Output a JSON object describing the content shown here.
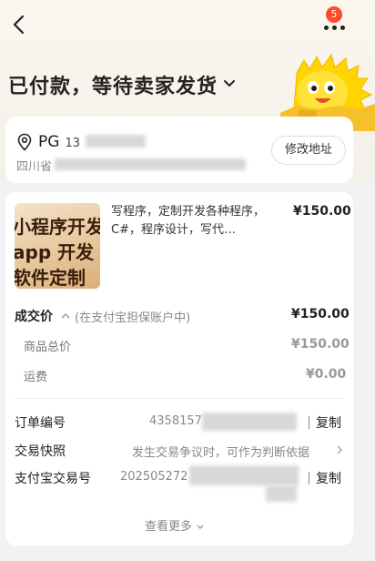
{
  "header": {
    "badge_count": "5",
    "title": "已付款，等待卖家发货"
  },
  "address": {
    "name": "PG",
    "phone_prefix": "13",
    "line_prefix": "四川省",
    "edit_label": "修改地址"
  },
  "product": {
    "thumb_lines": [
      "小程序开发",
      "app 开发",
      "软件定制"
    ],
    "title": "写程序，定制开发各种程序，C#，程序设计，写代…",
    "price": "¥150.00"
  },
  "pricing": {
    "deal_label": "成交价",
    "deal_note": "(在支付宝担保账户中)",
    "deal_value": "¥150.00",
    "goods_label": "商品总价",
    "goods_value": "¥150.00",
    "shipping_label": "运费",
    "shipping_value": "¥0.00"
  },
  "order_info": {
    "order_no_label": "订单编号",
    "order_no_value": "4358157",
    "snapshot_label": "交易快照",
    "snapshot_value": "发生交易争议时，可作为判断依据",
    "alipay_label": "支付宝交易号",
    "alipay_value": "202505272",
    "copy_label": "复制",
    "see_more": "查看更多"
  },
  "colors": {
    "badge": "#ff4a2d",
    "mascot": "#ffd400"
  }
}
